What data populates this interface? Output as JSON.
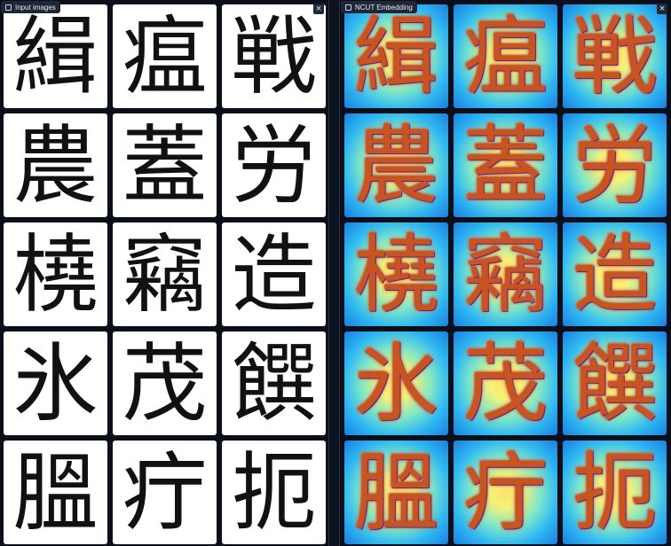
{
  "left_panel": {
    "title": "Input images",
    "close_icon": "close-icon",
    "tiles": [
      "緝",
      "瘟",
      "戦",
      "農",
      "蓋",
      "労",
      "橈",
      "竊",
      "造",
      "氷",
      "茂",
      "饌",
      "膃",
      "疔",
      "扼"
    ]
  },
  "right_panel": {
    "title": "NCUT Embedding",
    "close_icon": "close-icon",
    "tiles": [
      "緝",
      "瘟",
      "戦",
      "農",
      "蓋",
      "労",
      "橈",
      "竊",
      "造",
      "氷",
      "茂",
      "饌",
      "膃",
      "疔",
      "扼"
    ]
  },
  "colors": {
    "background": "#0b0f1a",
    "input_tile": "#ffffff",
    "embed_center": "#ffe36a",
    "embed_edge": "#1a7fe0",
    "embed_glyph": "#c8541f"
  }
}
